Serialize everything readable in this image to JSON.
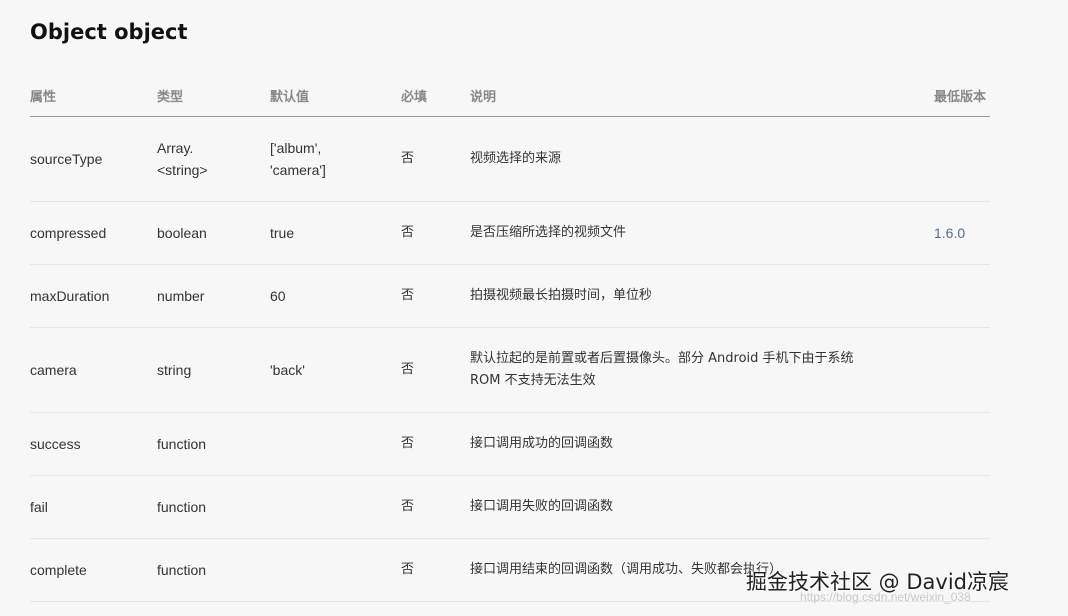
{
  "title": "Object object",
  "columns": {
    "attr": "属性",
    "type": "类型",
    "default": "默认值",
    "required": "必填",
    "desc": "说明",
    "version": "最低版本"
  },
  "rows": [
    {
      "attr": "sourceType",
      "type": "Array.<string>",
      "default": "['album', 'camera']",
      "required": "否",
      "desc": "视频选择的来源",
      "version": ""
    },
    {
      "attr": "compressed",
      "type": "boolean",
      "default": "true",
      "required": "否",
      "desc": "是否压缩所选择的视频文件",
      "version": "1.6.0"
    },
    {
      "attr": "maxDuration",
      "type": "number",
      "default": "60",
      "required": "否",
      "desc": "拍摄视频最长拍摄时间，单位秒",
      "version": ""
    },
    {
      "attr": "camera",
      "type": "string",
      "default": "'back'",
      "required": "否",
      "desc": "默认拉起的是前置或者后置摄像头。部分 Android 手机下由于系统 ROM 不支持无法生效",
      "version": ""
    },
    {
      "attr": "success",
      "type": "function",
      "default": "",
      "required": "否",
      "desc": "接口调用成功的回调函数",
      "version": ""
    },
    {
      "attr": "fail",
      "type": "function",
      "default": "",
      "required": "否",
      "desc": "接口调用失败的回调函数",
      "version": ""
    },
    {
      "attr": "complete",
      "type": "function",
      "default": "",
      "required": "否",
      "desc": "接口调用结束的回调函数（调用成功、失败都会执行）",
      "version": ""
    }
  ],
  "watermark": {
    "text": "掘金技术社区 @ David凉宸",
    "url": "https://blog.csdn.net/weixin_038"
  }
}
